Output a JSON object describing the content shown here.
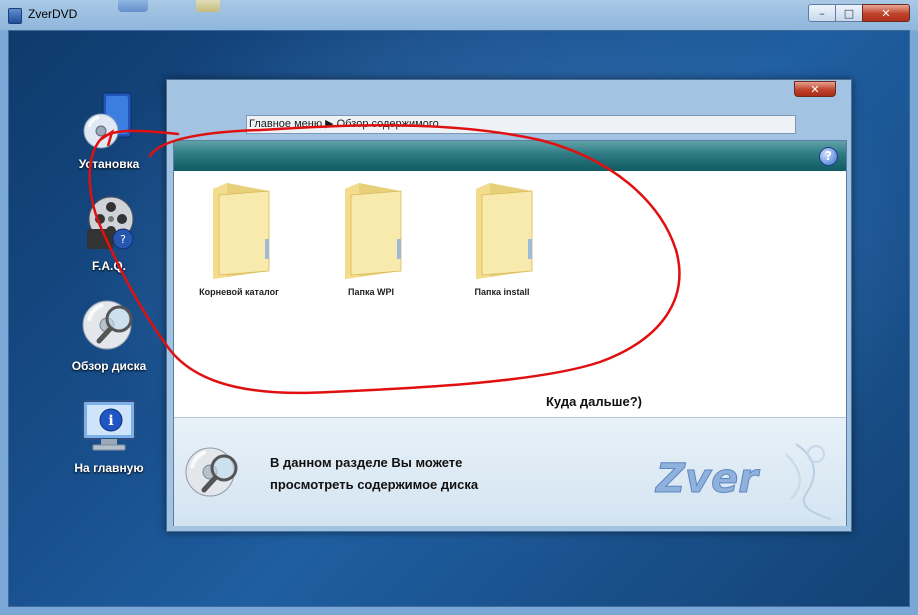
{
  "window": {
    "title": "ZverDVD",
    "controls": {
      "minimize": "–",
      "maximize": "□",
      "close": "✕"
    }
  },
  "sidebar": {
    "items": [
      {
        "label": "Установка",
        "icon": "install-disc-icon"
      },
      {
        "label": "F.A.Q.",
        "icon": "film-reel-icon"
      },
      {
        "label": "Обзор диска",
        "icon": "disc-magnifier-icon"
      },
      {
        "label": "На главную",
        "icon": "info-monitor-icon"
      }
    ]
  },
  "dialog": {
    "close": "✕",
    "breadcrumb": "Главное меню  ▶  Обзор содержимого",
    "help": "?",
    "folders": [
      {
        "label": "Корневой каталог"
      },
      {
        "label": "Папка WPI"
      },
      {
        "label": "Папка install"
      }
    ],
    "info_line1": "В данном разделе Вы можете",
    "info_line2": "просмотреть содержимое диска",
    "logo_text": "Zver"
  },
  "annotation": {
    "text": "Куда дальше?)",
    "color": "#e01010"
  }
}
